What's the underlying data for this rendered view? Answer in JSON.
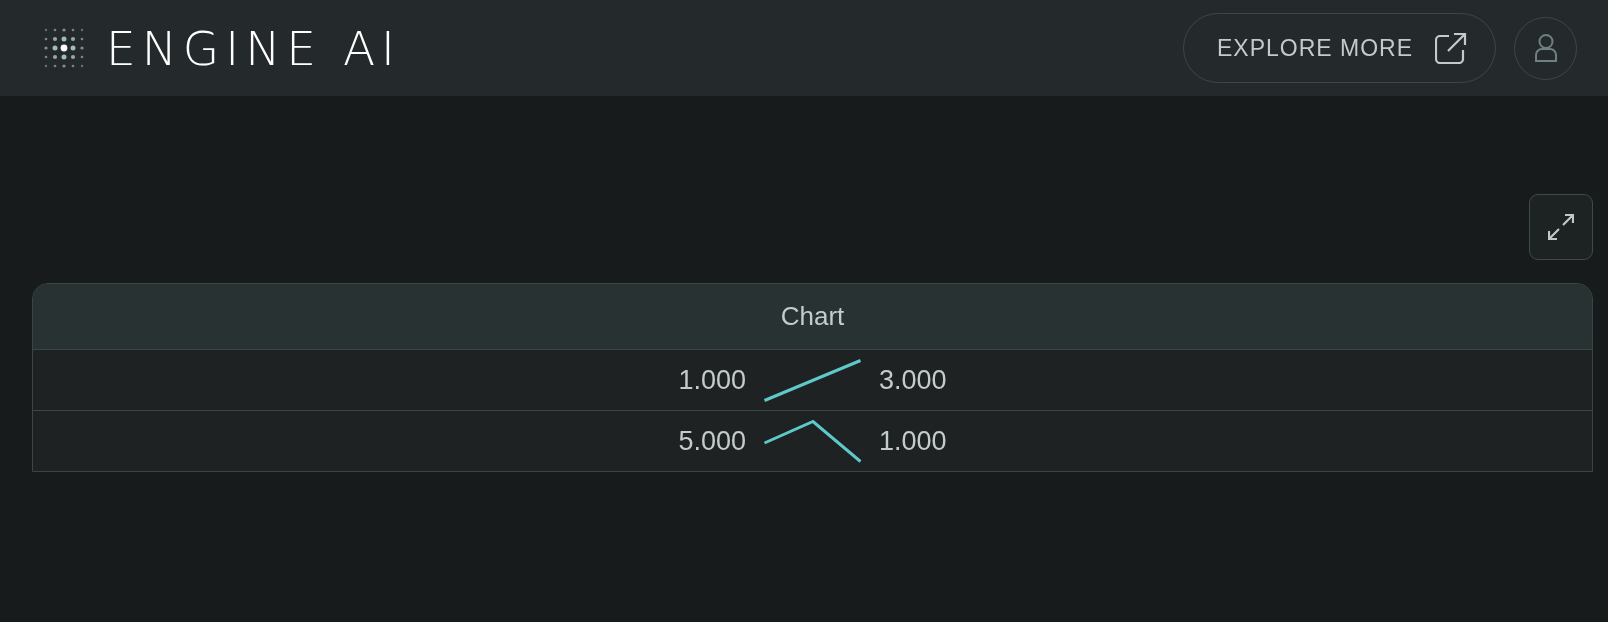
{
  "header": {
    "logo": {
      "text": "ENGINE AI"
    },
    "explore_button": {
      "label": "EXPLORE MORE"
    }
  },
  "table": {
    "columns": [
      "Chart"
    ],
    "rows": [
      {
        "start": "1.000",
        "end": "3.000",
        "kind": "rising"
      },
      {
        "start": "5.000",
        "end": "1.000",
        "kind": "peak"
      }
    ]
  }
}
